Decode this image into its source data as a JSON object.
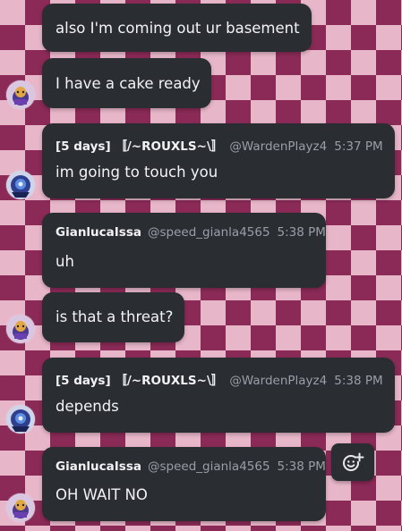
{
  "messages": [
    {
      "text": "also I'm coming out ur basement"
    },
    {
      "text": "I have a cake ready"
    },
    {
      "author": "[5 days] 〚/~ROUXLS~\\〛",
      "handle": "@WardenPlayz4",
      "time": "5:37 PM",
      "text": "im going to touch you"
    },
    {
      "author": "GianlucaIssa",
      "handle": "@speed_gianla4565",
      "time": "5:38 PM",
      "text": "uh"
    },
    {
      "text": "is that a threat?"
    },
    {
      "author": "[5 days] 〚/~ROUXLS~\\〛",
      "handle": "@WardenPlayz4",
      "time": "5:38 PM",
      "text": "depends"
    },
    {
      "author": "GianlucaIssa",
      "handle": "@speed_gianla4565",
      "time": "5:38 PM",
      "text": "OH WAIT NO"
    }
  ],
  "icons": {
    "avatar_gianluca": "gianluca-avatar-icon",
    "avatar_rouxls": "rouxls-avatar-icon",
    "add_reaction": "add-reaction-icon"
  },
  "colors": {
    "bubble": "#2a2d31",
    "checker_dark": "#8b2a57",
    "checker_light": "#e7b6c9",
    "muted_text": "#9a9ea6"
  }
}
